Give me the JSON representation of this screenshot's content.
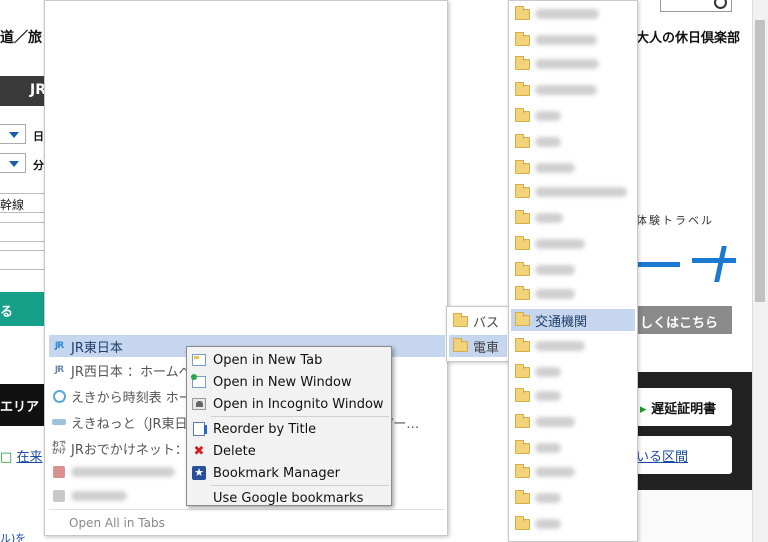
{
  "background_page": {
    "left_title": "道／旅",
    "dark_tab": "JR",
    "select_1_label": "日",
    "select_2_label": "分",
    "input_value": "幹線",
    "search_button": "る",
    "area_tab": "エリア",
    "left_link_prefix": "□",
    "left_link": "在来",
    "bottom_left": "ル)を",
    "club_title": "大人の休日倶楽部",
    "travel_text": "体験トラベル",
    "details_button": "しくはこちら",
    "cert_arrow": "▸",
    "cert_button": "遅延証明書",
    "range_button": "いる区間"
  },
  "bookmarks_panel": {
    "items": [
      {
        "label": "JR東日本",
        "favicon": "jr-logo"
      },
      {
        "label": "JR西日本 ：ホームペ",
        "favicon": "jr-logo"
      },
      {
        "label": "えきから時刻表 ホー",
        "favicon": "clock"
      },
      {
        "label": "えきねっと（JR東日",
        "favicon": "ekinet"
      },
      {
        "label": "JRおでかけネット：",
        "favicon": "odekake"
      }
    ],
    "truncated_fragment": "アー…",
    "open_all": "Open All in Tabs"
  },
  "subfolder_panel": {
    "items": [
      {
        "label": "バス"
      },
      {
        "label": "電車"
      }
    ]
  },
  "folder_list": {
    "selected_label": "交通機関",
    "blurred_count_above": 12,
    "blurred_count_below": 8
  },
  "context_menu": {
    "items": [
      {
        "label": "Open in New Tab",
        "icon": "new-tab-icon"
      },
      {
        "label": "Open in New Window",
        "icon": "new-window-icon"
      },
      {
        "label": "Open in Incognito Window",
        "icon": "incognito-icon"
      },
      {
        "label": "Reorder by Title",
        "icon": "reorder-icon"
      },
      {
        "label": "Delete",
        "icon": "delete-icon"
      },
      {
        "label": "Bookmark Manager",
        "icon": "star-icon"
      },
      {
        "label": "Use Google bookmarks",
        "icon": ""
      }
    ]
  }
}
